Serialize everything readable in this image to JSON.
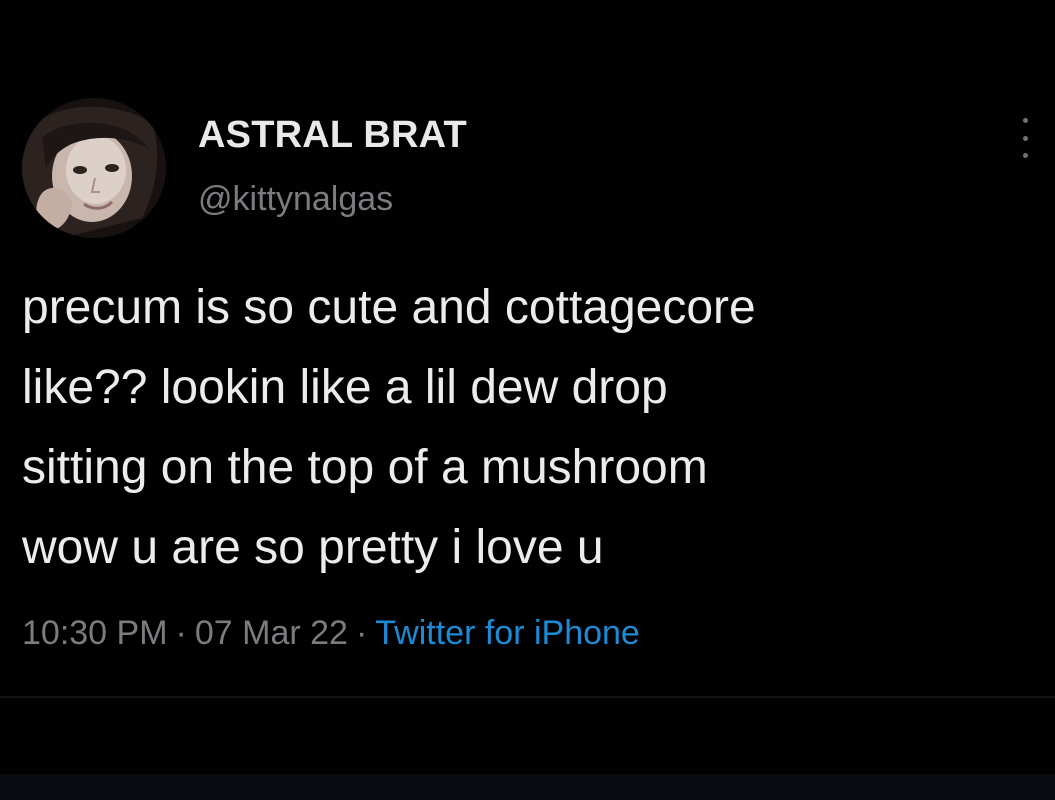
{
  "tweet": {
    "author": {
      "display_name": "ASTRAL BRAT",
      "handle": "@kittynalgas",
      "avatar_icon": "profile-photo"
    },
    "text_lines": [
      "precum is so cute and cottagecore",
      "like?? lookin like a lil dew drop",
      "sitting on the top of a mushroom",
      "wow u are so pretty i love u"
    ],
    "meta": {
      "time": "10:30 PM",
      "separator": "·",
      "date": "07 Mar 22",
      "source": "Twitter for iPhone"
    },
    "more_icon": "more-vertical-icon"
  },
  "colors": {
    "background": "#000000",
    "primary_text": "#ececec",
    "secondary_text": "#7a7c80",
    "link": "#1d8ad6"
  }
}
